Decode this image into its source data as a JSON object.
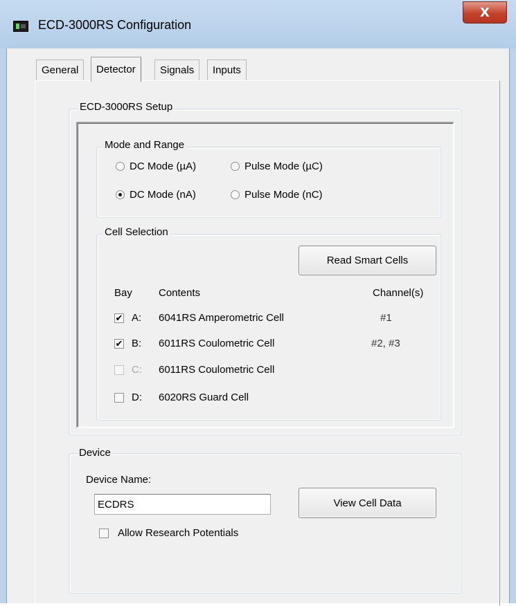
{
  "window": {
    "title": "ECD-3000RS Configuration",
    "close_glyph": "X",
    "icon": "app-window-icon"
  },
  "tabs": [
    {
      "label": "General",
      "active": false
    },
    {
      "label": "Detector",
      "active": true
    },
    {
      "label": "Signals",
      "active": false
    },
    {
      "label": "Inputs",
      "active": false
    }
  ],
  "setup": {
    "group_label": "ECD-3000RS Setup",
    "mode_range": {
      "group_label": "Mode and Range",
      "options": [
        {
          "label": "DC Mode (µA)",
          "selected": false
        },
        {
          "label": "Pulse Mode (µC)",
          "selected": false
        },
        {
          "label": "DC Mode (nA)",
          "selected": true
        },
        {
          "label": "Pulse Mode (nC)",
          "selected": false
        }
      ]
    },
    "cell_selection": {
      "group_label": "Cell Selection",
      "read_button": "Read Smart Cells",
      "headers": {
        "bay": "Bay",
        "contents": "Contents",
        "channels": "Channel(s)"
      },
      "rows": [
        {
          "bay": "A:",
          "contents": "6041RS Amperometric Cell",
          "channels": "#1",
          "checked": true,
          "enabled": true
        },
        {
          "bay": "B:",
          "contents": "6011RS Coulometric Cell",
          "channels": "#2, #3",
          "checked": true,
          "enabled": true
        },
        {
          "bay": "C:",
          "contents": "6011RS Coulometric Cell",
          "channels": "",
          "checked": false,
          "enabled": false
        },
        {
          "bay": "D:",
          "contents": "6020RS Guard Cell",
          "channels": "",
          "checked": false,
          "enabled": true
        }
      ]
    }
  },
  "device": {
    "group_label": "Device",
    "name_label": "Device Name:",
    "name_value": "ECDRS",
    "view_button": "View Cell Data",
    "allow_research_label": "Allow Research Potentials",
    "allow_research_checked": false
  },
  "check_glyph": "✔"
}
